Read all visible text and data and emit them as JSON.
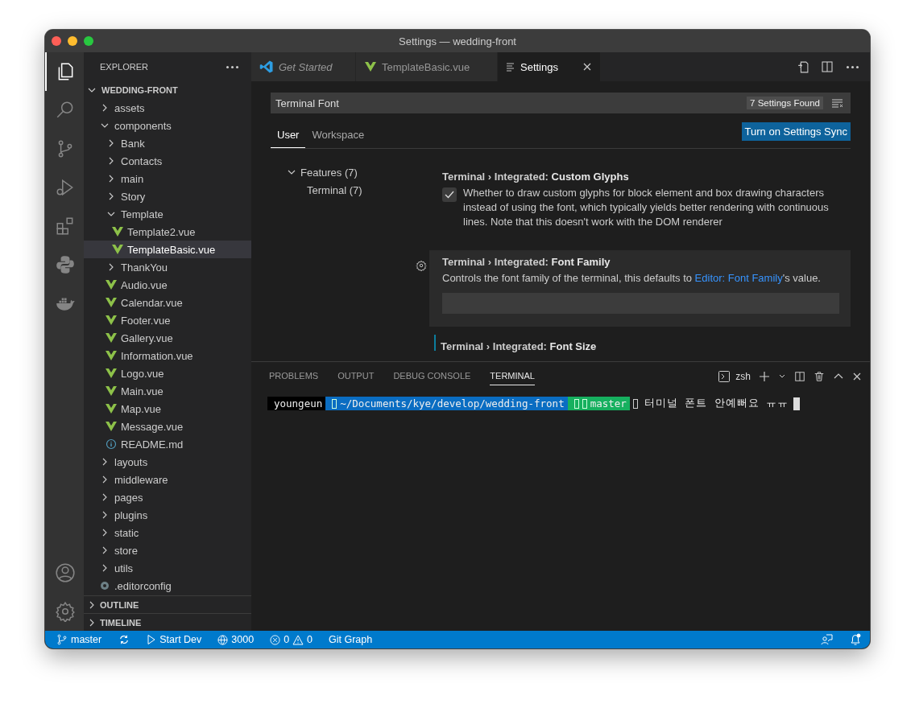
{
  "window": {
    "title": "Settings — wedding-front"
  },
  "activity_bar": {
    "top": [
      {
        "kind": "explorer",
        "selected": true
      },
      {
        "kind": "search",
        "selected": false
      },
      {
        "kind": "source_control",
        "selected": false
      },
      {
        "kind": "run",
        "selected": false
      },
      {
        "kind": "extensions",
        "selected": false
      },
      {
        "kind": "python",
        "selected": false
      },
      {
        "kind": "docker",
        "selected": false
      }
    ],
    "bottom": [
      {
        "kind": "account",
        "selected": false
      },
      {
        "kind": "manage",
        "selected": false
      }
    ]
  },
  "sidebar": {
    "title": "EXPLORER",
    "tree": {
      "label": "WEDDING-FRONT",
      "expanded": true,
      "children": [
        {
          "label": "assets",
          "kind": "folder",
          "expanded": false,
          "selected": false
        },
        {
          "label": "components",
          "kind": "folder",
          "expanded": true,
          "selected": false,
          "children": [
            {
              "label": "Bank",
              "kind": "folder",
              "expanded": false,
              "selected": false
            },
            {
              "label": "Contacts",
              "kind": "folder",
              "expanded": false,
              "selected": false
            },
            {
              "label": "main",
              "kind": "folder",
              "expanded": false,
              "selected": false
            },
            {
              "label": "Story",
              "kind": "folder",
              "expanded": false,
              "selected": false
            },
            {
              "label": "Template",
              "kind": "folder",
              "expanded": true,
              "selected": false,
              "children": [
                {
                  "label": "Template2.vue",
                  "kind": "vue",
                  "selected": false
                },
                {
                  "label": "TemplateBasic.vue",
                  "kind": "vue",
                  "selected": true
                }
              ]
            },
            {
              "label": "ThankYou",
              "kind": "folder",
              "expanded": false,
              "selected": false
            },
            {
              "label": "Audio.vue",
              "kind": "vue",
              "selected": false
            },
            {
              "label": "Calendar.vue",
              "kind": "vue",
              "selected": false
            },
            {
              "label": "Footer.vue",
              "kind": "vue",
              "selected": false
            },
            {
              "label": "Gallery.vue",
              "kind": "vue",
              "selected": false
            },
            {
              "label": "Information.vue",
              "kind": "vue",
              "selected": false
            },
            {
              "label": "Logo.vue",
              "kind": "vue",
              "selected": false
            },
            {
              "label": "Main.vue",
              "kind": "vue",
              "selected": false
            },
            {
              "label": "Map.vue",
              "kind": "vue",
              "selected": false
            },
            {
              "label": "Message.vue",
              "kind": "vue",
              "selected": false
            },
            {
              "label": "README.md",
              "kind": "info",
              "selected": false
            }
          ]
        },
        {
          "label": "layouts",
          "kind": "folder",
          "expanded": false,
          "selected": false
        },
        {
          "label": "middleware",
          "kind": "folder",
          "expanded": false,
          "selected": false
        },
        {
          "label": "pages",
          "kind": "folder",
          "expanded": false,
          "selected": false
        },
        {
          "label": "plugins",
          "kind": "folder",
          "expanded": false,
          "selected": false
        },
        {
          "label": "static",
          "kind": "folder",
          "expanded": false,
          "selected": false
        },
        {
          "label": "store",
          "kind": "folder",
          "expanded": false,
          "selected": false
        },
        {
          "label": "utils",
          "kind": "folder",
          "expanded": false,
          "selected": false
        },
        {
          "label": ".editorconfig",
          "kind": "config",
          "selected": false
        }
      ]
    },
    "sections": [
      {
        "label": "OUTLINE",
        "expanded": false
      },
      {
        "label": "TIMELINE",
        "expanded": false
      }
    ]
  },
  "tabs": [
    {
      "label": "Get Started",
      "kind": "welcome",
      "preview": true,
      "selected": false
    },
    {
      "label": "TemplateBasic.vue",
      "kind": "vue",
      "preview": false,
      "selected": false
    },
    {
      "label": "Settings",
      "kind": "settings",
      "preview": false,
      "selected": true
    }
  ],
  "settings": {
    "search": {
      "value": "Terminal Font",
      "result_count": "7 Settings Found"
    },
    "scopes": [
      {
        "label": "User",
        "selected": true
      },
      {
        "label": "Workspace",
        "selected": false
      }
    ],
    "sync_button": "Turn on Settings Sync",
    "toc": [
      {
        "label": "Features (7)",
        "expanded": true,
        "children": [
          {
            "label": "Terminal (7)"
          }
        ]
      }
    ],
    "items": [
      {
        "kind": "checkbox",
        "category": "Terminal › Integrated: ",
        "name": "Custom Glyphs",
        "focused": false,
        "modified": false,
        "checked": true,
        "description": "Whether to draw custom glyphs for block element and box drawing characters instead of using the font, which typically yields better rendering with continuous lines. Note that this doesn't work with the DOM renderer"
      },
      {
        "kind": "text",
        "category": "Terminal › Integrated: ",
        "name": "Font Family",
        "focused": true,
        "modified": false,
        "description": "Controls the font family of the terminal, this defaults to ",
        "link": "Editor: Font Family",
        "description_end": "'s value."
      },
      {
        "kind": "heading",
        "category": "Terminal › Integrated: ",
        "name": "Font Size",
        "focused": false,
        "modified": true
      }
    ]
  },
  "panel": {
    "tabs": [
      {
        "label": "PROBLEMS",
        "selected": false
      },
      {
        "label": "OUTPUT",
        "selected": false
      },
      {
        "label": "DEBUG CONSOLE",
        "selected": false
      },
      {
        "label": "TERMINAL",
        "selected": true
      }
    ],
    "shell": "zsh",
    "prompt": [
      {
        "kind": "user",
        "text": "youngeun",
        "color": "#000000"
      },
      {
        "kind": "path",
        "text": "~/Documents/kye/develop/wedding-front",
        "color": "#0a6dc2"
      },
      {
        "kind": "git",
        "text": "master",
        "color": "#16b05f"
      }
    ],
    "input": "터미널 폰트 안예뻐요 ㅠㅠ"
  },
  "status_bar": {
    "branch": "master",
    "task": "Start Dev",
    "port": "3000",
    "errors": "0",
    "warnings": "0",
    "git_graph": "Git Graph"
  }
}
